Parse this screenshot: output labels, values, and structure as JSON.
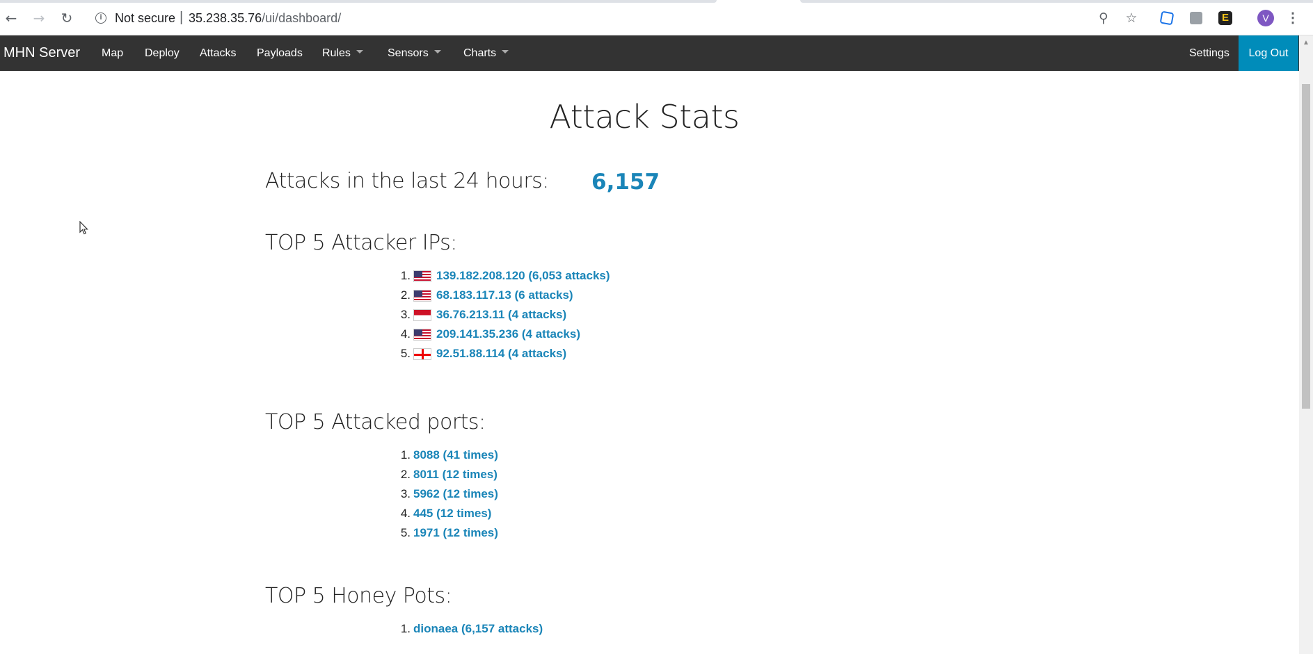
{
  "browser": {
    "security_label": "Not secure",
    "url_host": "35.238.35.76",
    "url_path": "/ui/dashboard/",
    "profile_initial": "V"
  },
  "navbar": {
    "brand": "MHN Server",
    "items": [
      {
        "label": "Map"
      },
      {
        "label": "Deploy"
      },
      {
        "label": "Attacks"
      },
      {
        "label": "Payloads"
      },
      {
        "label": "Rules"
      },
      {
        "label": "Sensors"
      },
      {
        "label": "Charts"
      }
    ],
    "settings": "Settings",
    "logout": "Log Out"
  },
  "page": {
    "title": "Attack Stats",
    "attacks_24h_label": "Attacks in the last 24 hours:",
    "attacks_24h_value": "6,157",
    "top_ips_heading": "TOP 5 Attacker IPs:",
    "top_ips": [
      {
        "rank": "1.",
        "flag": "us",
        "text": "139.182.208.120 (6,053 attacks)"
      },
      {
        "rank": "2.",
        "flag": "us",
        "text": "68.183.117.13 (6 attacks)"
      },
      {
        "rank": "3.",
        "flag": "id",
        "text": "36.76.213.11 (4 attacks)"
      },
      {
        "rank": "4.",
        "flag": "us",
        "text": "209.141.35.236 (4 attacks)"
      },
      {
        "rank": "5.",
        "flag": "ge",
        "text": "92.51.88.114 (4 attacks)"
      }
    ],
    "top_ports_heading": "TOP 5 Attacked ports:",
    "top_ports": [
      {
        "rank": "1.",
        "text": "8088 (41 times)"
      },
      {
        "rank": "2.",
        "text": "8011 (12 times)"
      },
      {
        "rank": "3.",
        "text": "5962 (12 times)"
      },
      {
        "rank": "4.",
        "text": "445 (12 times)"
      },
      {
        "rank": "5.",
        "text": "1971 (12 times)"
      }
    ],
    "top_honeypots_heading": "TOP 5 Honey Pots:",
    "top_honeypots": [
      {
        "rank": "1.",
        "text": "dionaea (6,157 attacks)"
      }
    ]
  },
  "colors": {
    "navbar_bg": "#333333",
    "accent": "#008cba",
    "link": "#1a85b8"
  }
}
